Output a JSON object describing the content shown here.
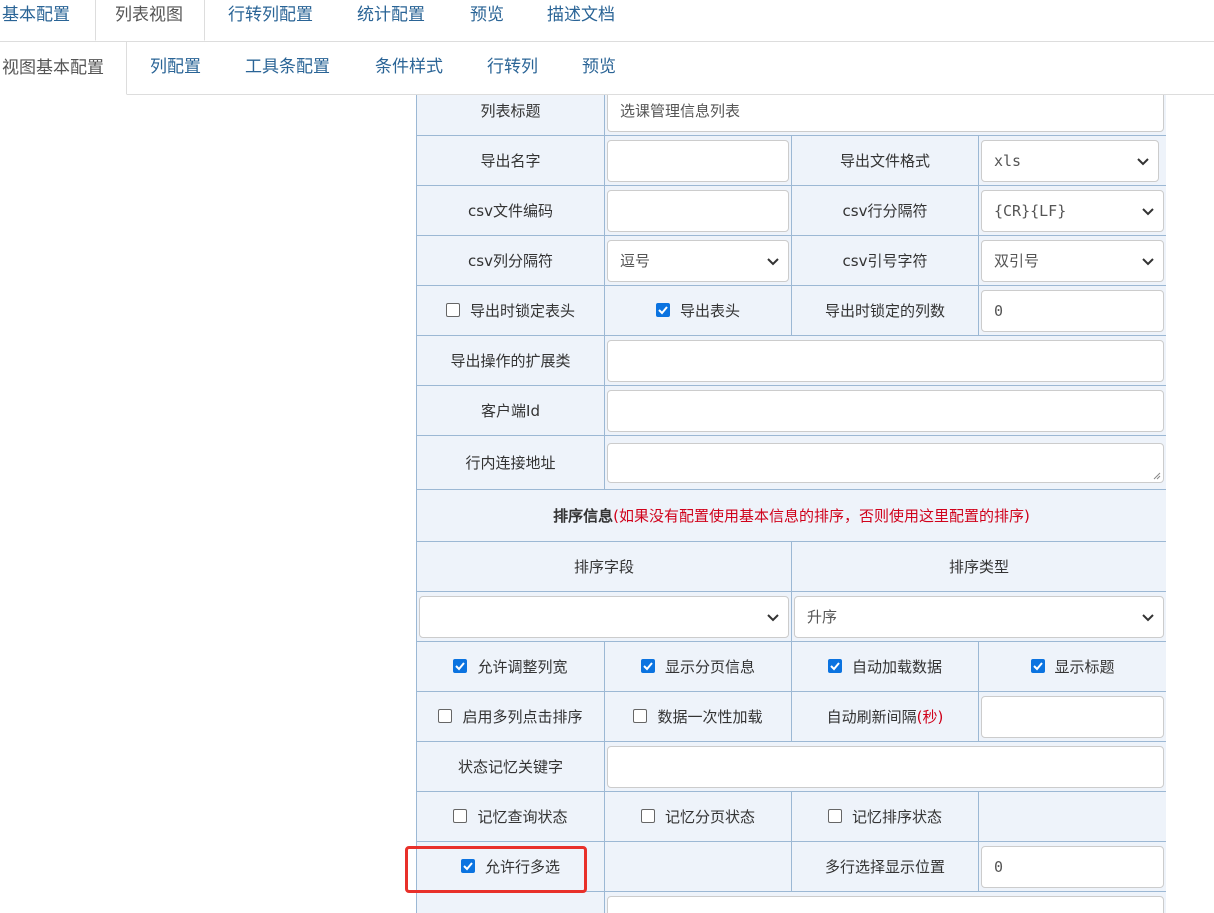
{
  "tabs_top": [
    "基本配置",
    "列表视图",
    "行转列配置",
    "统计配置",
    "预览",
    "描述文档"
  ],
  "tabs_sub": [
    "视图基本配置",
    "列配置",
    "工具条配置",
    "条件样式",
    "行转列",
    "预览"
  ],
  "form": {
    "list_title_label": "列表标题",
    "list_title_value": "选课管理信息列表",
    "export_name_label": "导出名字",
    "export_name_value": "",
    "export_format_label": "导出文件格式",
    "export_format_value": "xls",
    "csv_encoding_label": "csv文件编码",
    "csv_encoding_value": "",
    "csv_row_sep_label": "csv行分隔符",
    "csv_row_sep_value": "{CR}{LF}",
    "csv_col_sep_label": "csv列分隔符",
    "csv_col_sep_value": "逗号",
    "csv_quote_label": "csv引号字符",
    "csv_quote_value": "双引号",
    "lock_header_label": "导出时锁定表头",
    "lock_header_checked": false,
    "export_header_label": "导出表头",
    "export_header_checked": true,
    "lock_cols_label": "导出时锁定的列数",
    "lock_cols_value": "0",
    "export_ext_label": "导出操作的扩展类",
    "export_ext_value": "",
    "client_id_label": "客户端Id",
    "client_id_value": "",
    "inline_link_label": "行内连接地址",
    "inline_link_value": "",
    "sort_section_title": "排序信息",
    "sort_section_note": "(如果没有配置使用基本信息的排序，否则使用这里配置的排序)",
    "sort_field_label": "排序字段",
    "sort_type_label": "排序类型",
    "sort_field_value": "",
    "sort_type_value": "升序",
    "allow_resize_label": "允许调整列宽",
    "allow_resize_checked": true,
    "show_paging_label": "显示分页信息",
    "show_paging_checked": true,
    "auto_load_label": "自动加载数据",
    "auto_load_checked": true,
    "show_title_label": "显示标题",
    "show_title_checked": true,
    "multi_sort_label": "启用多列点击排序",
    "multi_sort_checked": false,
    "load_once_label": "数据一次性加载",
    "load_once_checked": false,
    "auto_refresh_label": "自动刷新间隔",
    "auto_refresh_unit": "(秒)",
    "auto_refresh_value": "",
    "state_key_label": "状态记忆关键字",
    "state_key_value": "",
    "remember_query_label": "记忆查询状态",
    "remember_query_checked": false,
    "remember_page_label": "记忆分页状态",
    "remember_page_checked": false,
    "remember_sort_label": "记忆排序状态",
    "remember_sort_checked": false,
    "multi_select_label": "允许行多选",
    "multi_select_checked": true,
    "multi_select_pos_label": "多行选择显示位置",
    "multi_select_pos_value": "0"
  },
  "colors": {
    "accent": "#0b73e0",
    "link": "#2a6496",
    "cell_bg": "#eef3fa",
    "border": "#9cb8d4",
    "highlight": "#e8302a",
    "note": "#d0021b"
  }
}
